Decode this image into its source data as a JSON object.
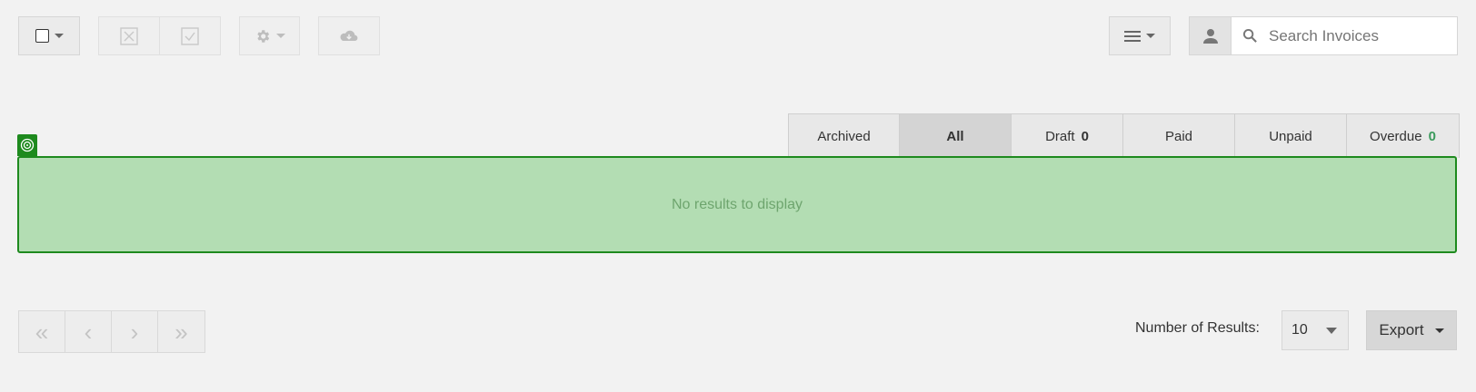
{
  "toolbar": {
    "select_icon": "checkbox-icon",
    "void_icon": "x-box-icon",
    "approve_icon": "check-box-icon",
    "settings_icon": "gear-icon",
    "download_icon": "cloud-download-icon",
    "view_icon": "list-icon",
    "user_icon": "user-icon"
  },
  "search": {
    "placeholder": "Search Invoices",
    "icon": "search-icon"
  },
  "tabs": [
    {
      "label": "Archived",
      "count": ""
    },
    {
      "label": "All",
      "count": ""
    },
    {
      "label": "Draft",
      "count": "0"
    },
    {
      "label": "Paid",
      "count": ""
    },
    {
      "label": "Unpaid",
      "count": ""
    },
    {
      "label": "Overdue",
      "count": "0"
    }
  ],
  "active_tab": "All",
  "results": {
    "empty_message": "No results to display"
  },
  "pagination": {
    "first": "«",
    "prev": "‹",
    "next": "›",
    "last": "»"
  },
  "footer": {
    "results_label": "Number of Results:",
    "results_value": "10",
    "export_label": "Export"
  },
  "colors": {
    "accent_green": "#1e8a1e",
    "panel_fill": "#b3ddb3",
    "count_green": "#3a9a5c"
  }
}
